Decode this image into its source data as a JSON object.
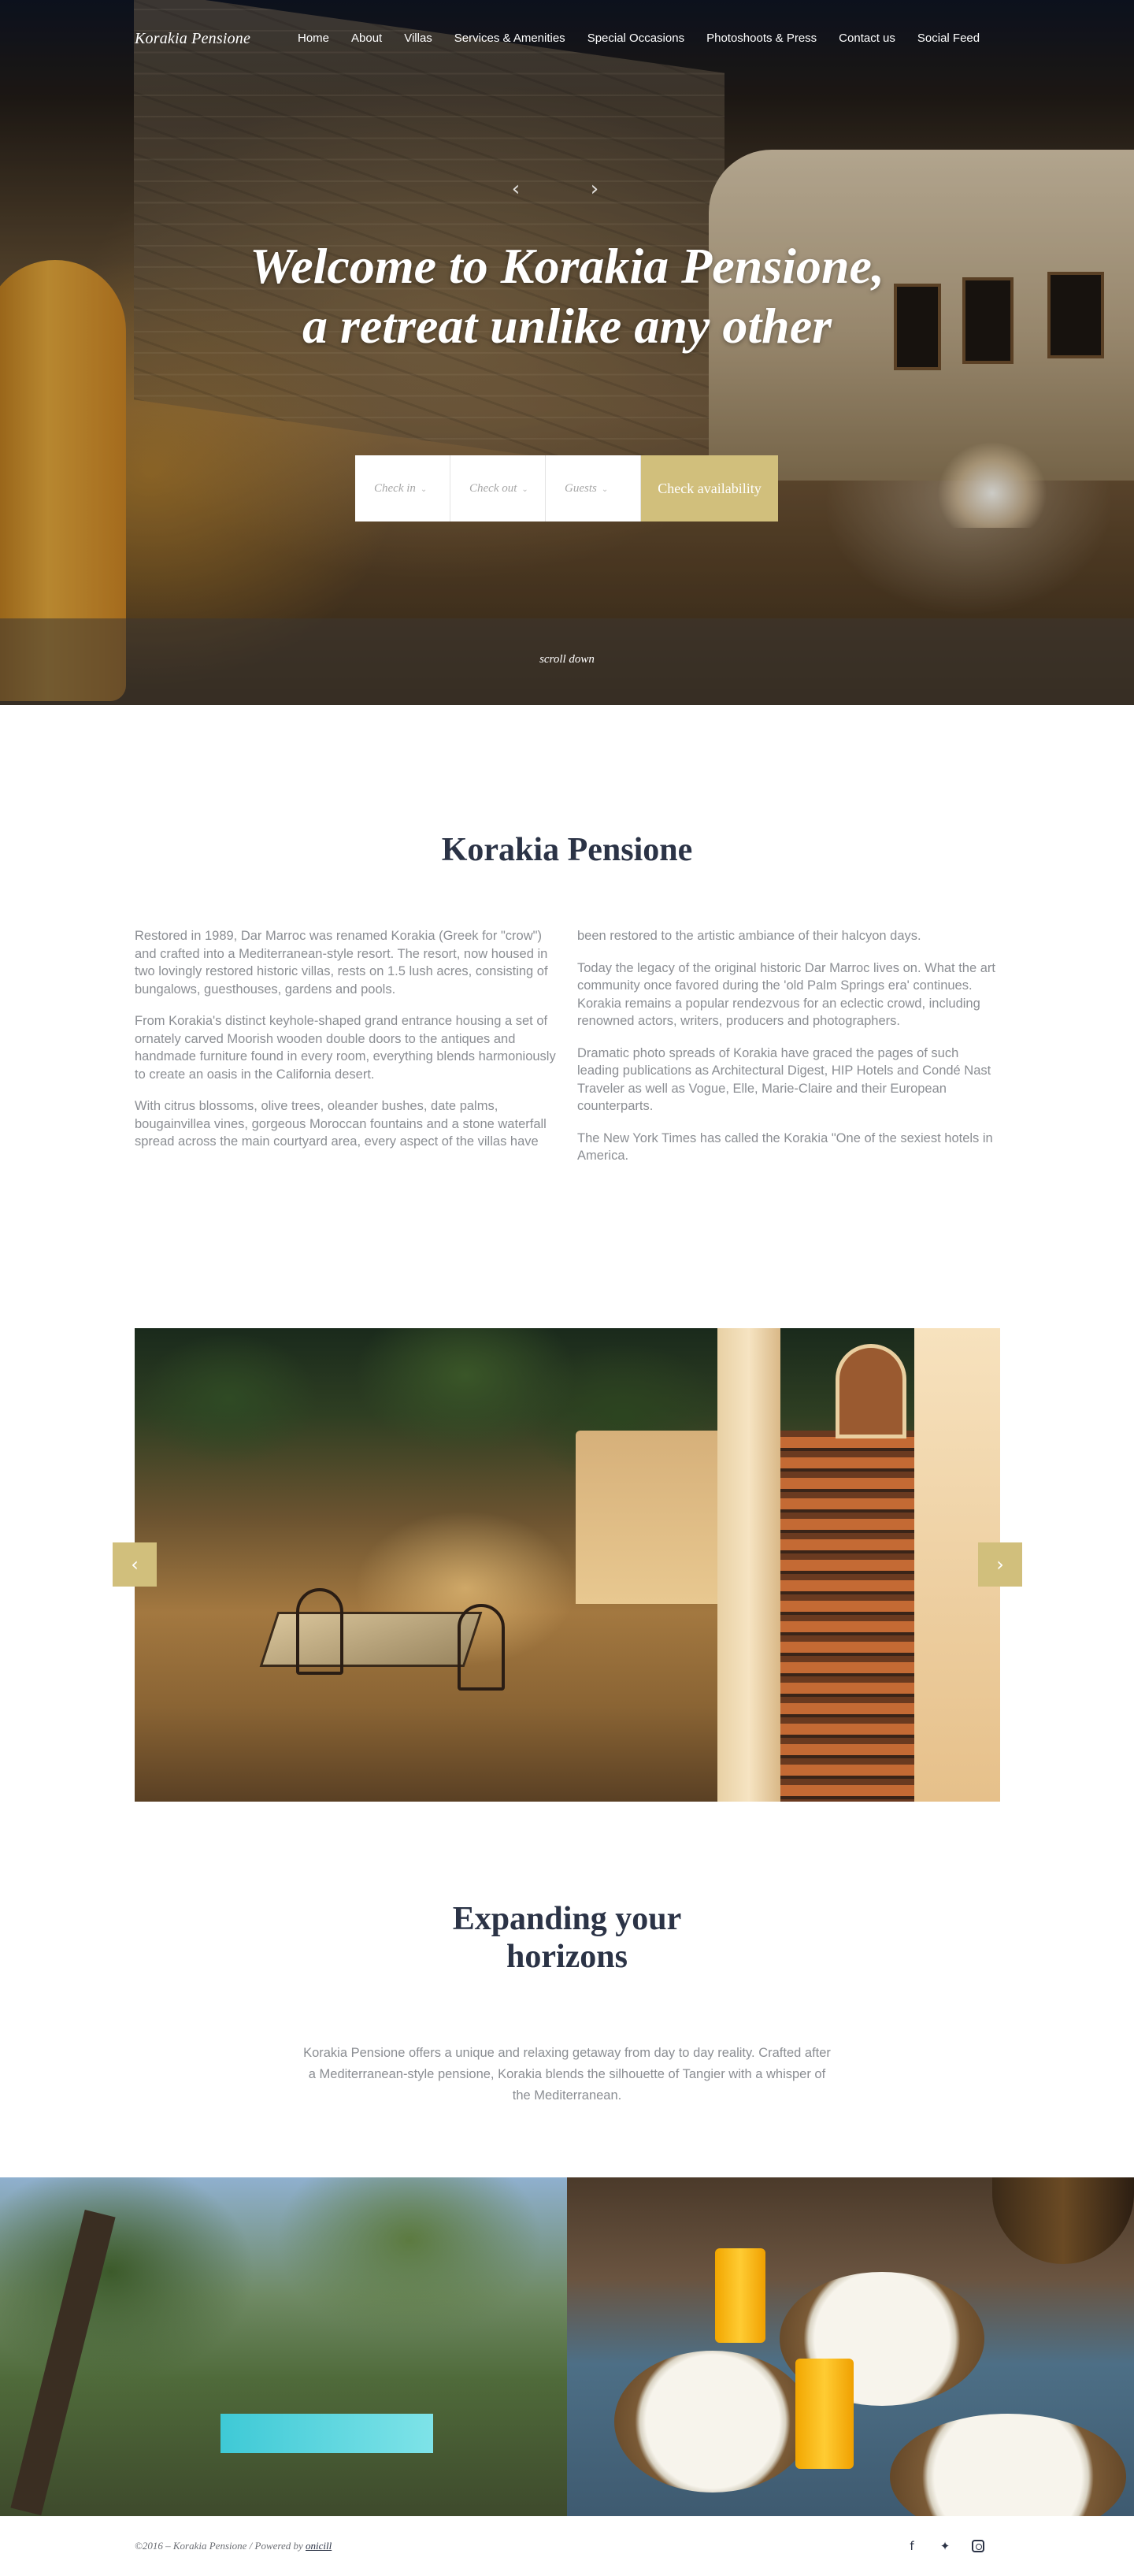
{
  "nav": {
    "logo": "Korakia Pensione",
    "items": [
      "Home",
      "About",
      "Villas",
      "Services & Amenities",
      "Special Occasions",
      "Photoshoots & Press",
      "Contact us",
      "Social Feed"
    ]
  },
  "hero": {
    "title_line1": "Welcome to Korakia Pensione,",
    "title_line2": "a retreat unlike any other",
    "booking": {
      "check_in": "Check in",
      "check_out": "Check out",
      "guests": "Guests",
      "button": "Check availability"
    },
    "scroll_label": "scroll down"
  },
  "about": {
    "title": "Korakia Pensione",
    "left_paragraphs": [
      "Restored in 1989, Dar Marroc was renamed Korakia (Greek for \"crow\") and crafted into a Mediterranean-style resort. The resort, now housed in two lovingly restored historic villas, rests on 1.5 lush acres, consisting of bungalows, guesthouses, gardens and pools.",
      "From Korakia's distinct keyhole-shaped grand entrance housing a set of ornately carved Moorish wooden double doors to the antiques and handmade furniture found in every room, everything blends harmoniously to create an oasis in the California desert.",
      "With citrus blossoms, olive trees, oleander bushes, date palms, bougainvillea vines, gorgeous Moroccan fountains and a stone waterfall spread across the main courtyard area, every aspect of the villas have"
    ],
    "right_paragraphs": [
      "been restored to the artistic ambiance of their halcyon days.",
      "Today the legacy of the original historic Dar Marroc lives on. What the art community once favored during the 'old Palm Springs era' continues. Korakia remains a popular rendezvous for an eclectic crowd, including renowned actors, writers, producers and photographers.",
      "Dramatic photo spreads of Korakia have graced the pages of such leading publications as Architectural Digest, HIP Hotels and Condé Nast Traveler as well as Vogue, Elle, Marie-Claire and their European counterparts.",
      "The New York Times has called the Korakia \"One of the sexiest hotels in America."
    ]
  },
  "gallery": {
    "prev_icon": "chevron-left-icon",
    "next_icon": "chevron-right-icon"
  },
  "expanding": {
    "title_line1": "Expanding your",
    "title_line2": "horizons",
    "text": "Korakia Pensione offers a unique and relaxing getaway from day to day reality. Crafted after a Mediterranean-style pensione, Korakia blends the silhouette of Tangier with a whisper of the Mediterranean."
  },
  "footer": {
    "copyright_prefix": "©2016 – Korakia Pensione / Powered by",
    "powered_link": "onicill",
    "social_icons": [
      "facebook-icon",
      "twitter-icon",
      "instagram-icon"
    ]
  },
  "colors": {
    "accent_gold": "#d1bf7c",
    "heading_navy": "#2b3346",
    "body_gray": "#8b8e93"
  }
}
